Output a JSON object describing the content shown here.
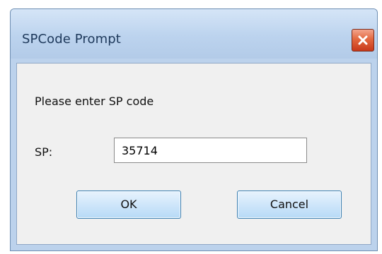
{
  "window": {
    "title": "SPCode Prompt",
    "close_icon": "close-icon"
  },
  "dialog": {
    "prompt": "Please enter SP code",
    "sp_label": "SP:",
    "sp_value": "35714",
    "ok_label": "OK",
    "cancel_label": "Cancel"
  },
  "colors": {
    "title_text": "#1e395b",
    "close_button": "#d9532e",
    "button_border": "#3c7fb1",
    "window_frame": "#bcd2ec",
    "client_bg": "#f0f0f0"
  }
}
